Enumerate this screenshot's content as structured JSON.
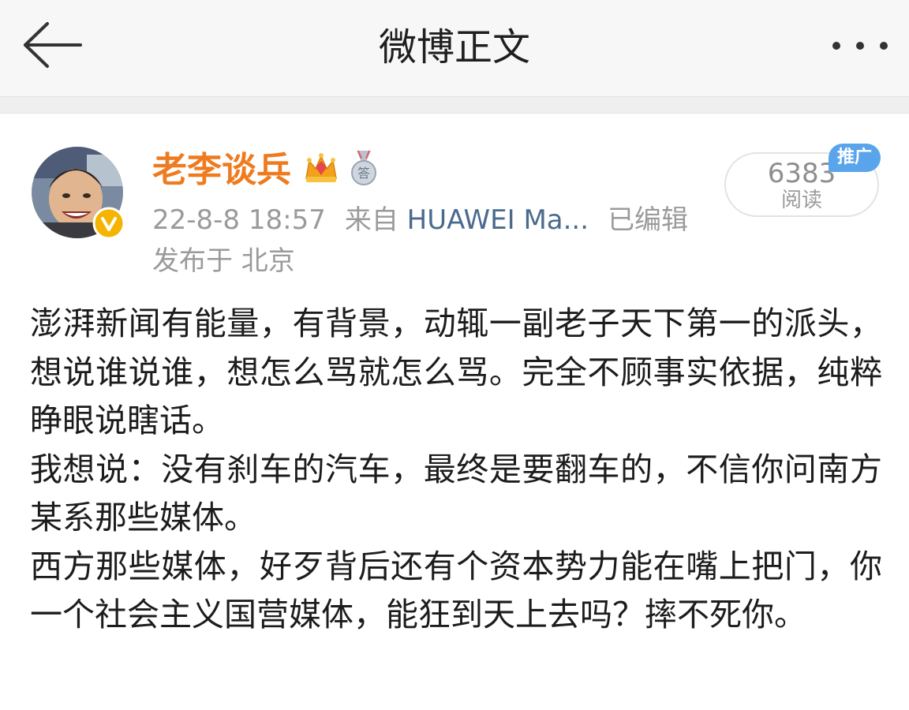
{
  "nav": {
    "title": "微博正文"
  },
  "post": {
    "author": "老李谈兵",
    "timestamp": "22-8-8 18:57",
    "source_prefix": "来自",
    "source": "HUAWEI Ma...",
    "edited": "已编辑",
    "location": "发布于 北京",
    "read_count": "6383",
    "read_label": "阅读",
    "promo_label": "推广",
    "paragraphs": [
      "澎湃新闻有能量，有背景，动辄一副老子天下第一的派头，想说谁说谁，想怎么骂就怎么骂。完全不顾事实依据，纯粹睁眼说瞎话。",
      "我想说：没有刹车的汽车，最终是要翻车的，不信你问南方某系那些媒体。",
      "西方那些媒体，好歹背后还有个资本势力能在嘴上把门，你一个社会主义国营媒体，能狂到天上去吗？摔不死你。"
    ]
  },
  "icons": {
    "back": "back-arrow-icon",
    "more": "more-dots-icon",
    "verified": "verified-v-icon",
    "vip": "vip-crown-icon",
    "medal": "answer-medal-icon"
  },
  "colors": {
    "author_name": "#ee7b1f",
    "source_link": "#4a6a8e",
    "meta_text": "#9a9a9a",
    "promo_badge": "#5aa4ec",
    "verified_badge": "#f5b400"
  }
}
